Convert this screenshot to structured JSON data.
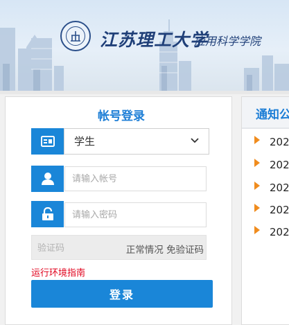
{
  "header": {
    "school_name": "江苏理工大学",
    "college_name": "应用科学学院"
  },
  "login": {
    "title": "帐号登录",
    "role_selected": "学生",
    "username_placeholder": "请输入帐号",
    "password_placeholder": "请输入密码",
    "captcha_placeholder": "验证码",
    "captcha_status": "正常情况  免验证码",
    "env_guide_link": "运行环境指南",
    "login_button": "登录"
  },
  "notice": {
    "title": "通知公",
    "items": [
      "202",
      "202",
      "202",
      "202",
      "202"
    ]
  },
  "colors": {
    "accent": "#1a86d8",
    "title_blue": "#1d7ed6",
    "link_red": "#e0001b",
    "bullet_orange": "#f08c1e"
  },
  "icons": {
    "role": "id-card-icon",
    "username": "user-icon",
    "password": "lock-icon",
    "dropdown": "chevron-down-icon",
    "notice_bullet": "triangle-bullet-icon"
  }
}
